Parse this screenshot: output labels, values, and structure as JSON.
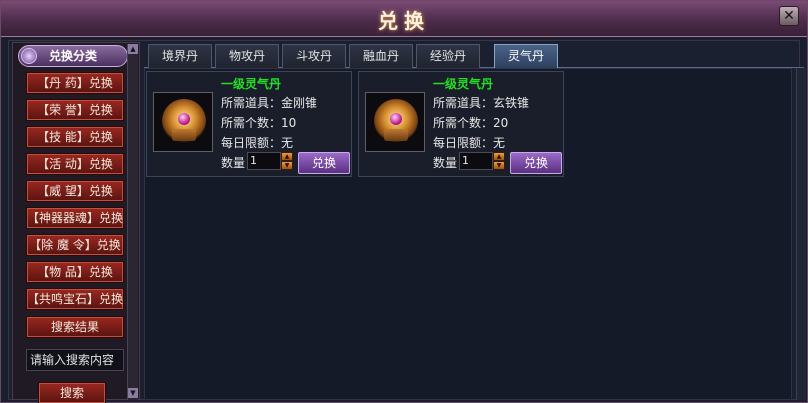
{
  "window": {
    "title": "兑换",
    "close_icon": "✕"
  },
  "sidebar": {
    "header": "兑换分类",
    "items": [
      {
        "label": "【丹  药】兑换"
      },
      {
        "label": "【荣  誉】兑换"
      },
      {
        "label": "【技  能】兑换"
      },
      {
        "label": "【活  动】兑换"
      },
      {
        "label": "【威  望】兑换"
      },
      {
        "label": "【神器器魂】兑换"
      },
      {
        "label": "【除 魔 令】兑换"
      },
      {
        "label": "【物  品】兑换"
      },
      {
        "label": "【共鸣宝石】兑换"
      },
      {
        "label": "搜索结果"
      }
    ],
    "search_placeholder": "请输入搜索内容",
    "search_button": "搜索"
  },
  "tabs": [
    {
      "label": "境界丹",
      "active": false
    },
    {
      "label": "物攻丹",
      "active": false
    },
    {
      "label": "斗攻丹",
      "active": false
    },
    {
      "label": "融血丹",
      "active": false
    },
    {
      "label": "经验丹",
      "active": false
    },
    {
      "label": "灵气丹",
      "active": true
    }
  ],
  "items": [
    {
      "name": "一级灵气丹",
      "required_item": "所需道具：金刚锥",
      "required_count": "所需个数：10",
      "daily_limit": "每日限额：无",
      "qty_label": "数量",
      "quantity": "1",
      "button": "兑换"
    },
    {
      "name": "一级灵气丹",
      "required_item": "所需道具：玄铁锥",
      "required_count": "所需个数：20",
      "daily_limit": "每日限额：无",
      "qty_label": "数量",
      "quantity": "1",
      "button": "兑换"
    }
  ],
  "colors": {
    "item_name": "#22e022",
    "active_tab": "#4a6488",
    "category_button": "#9a2820"
  }
}
